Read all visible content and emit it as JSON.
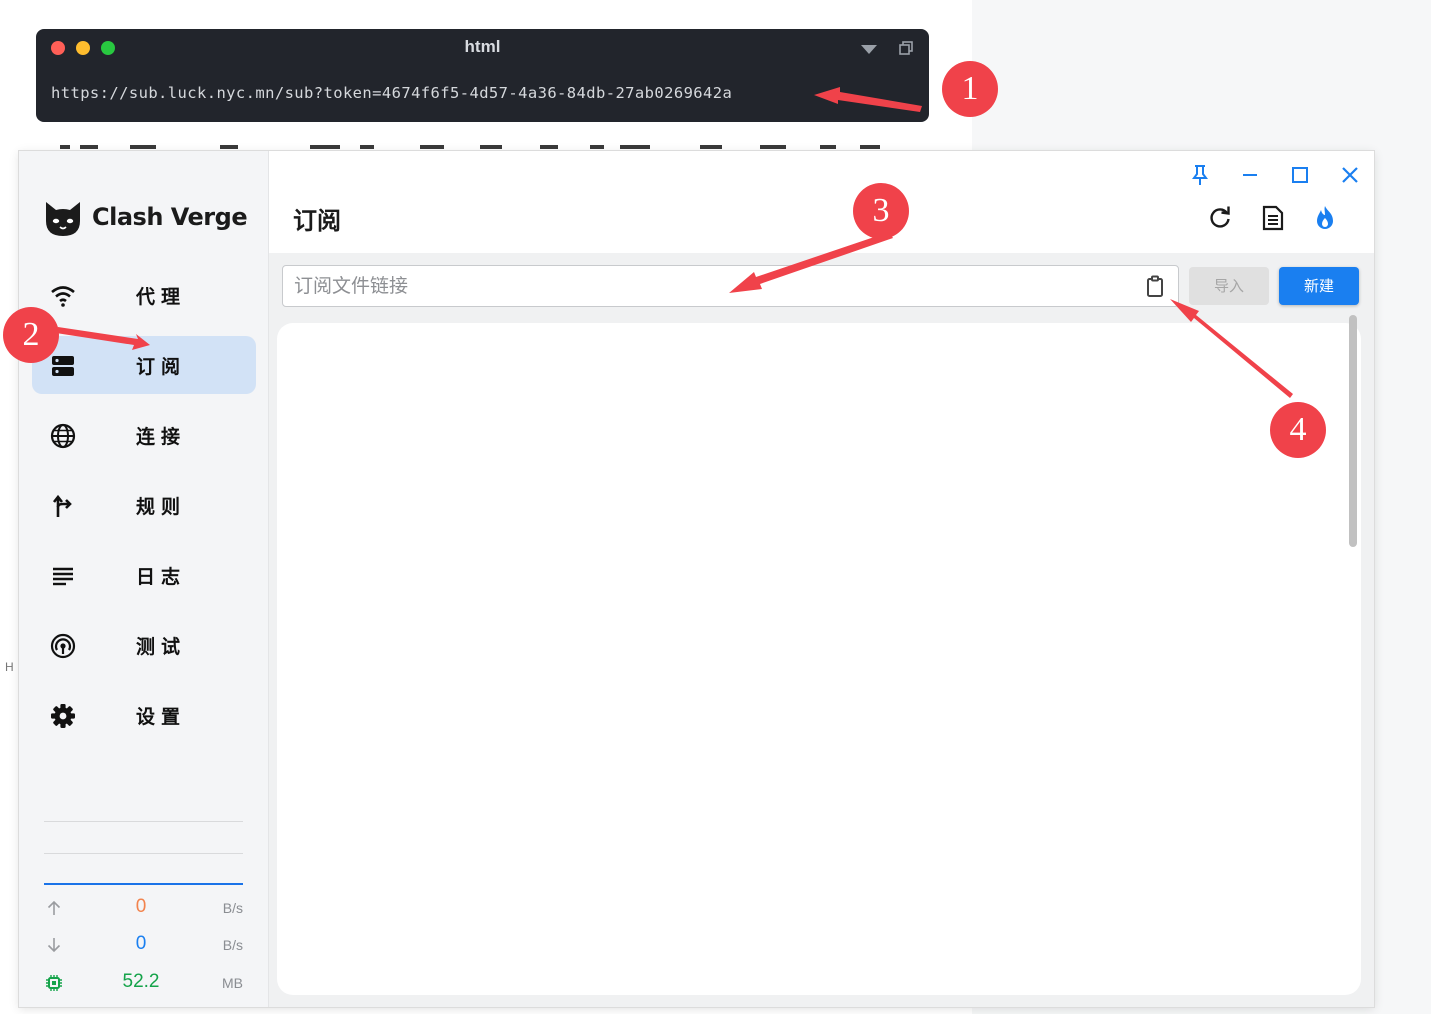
{
  "code_block": {
    "title": "html",
    "code": "https://sub.luck.nyc.mn/sub?token=4674f6f5-4d57-4a36-84db-27ab0269642a",
    "traffic_lights": [
      "#ff5f57",
      "#febc2e",
      "#28c840"
    ]
  },
  "side_note": "H",
  "app": {
    "brand": "Clash Verge",
    "accent": "#1a7ff0",
    "nav": [
      {
        "label": "代理",
        "icon": "wifi-icon"
      },
      {
        "label": "订阅",
        "icon": "server-icon",
        "active": true
      },
      {
        "label": "连接",
        "icon": "globe-icon"
      },
      {
        "label": "规则",
        "icon": "fork-icon"
      },
      {
        "label": "日志",
        "icon": "lines-icon"
      },
      {
        "label": "测试",
        "icon": "radar-icon"
      },
      {
        "label": "设置",
        "icon": "gear-icon"
      }
    ],
    "stats": {
      "upload": {
        "value": "0",
        "unit": "B/s",
        "color": "#f2834d"
      },
      "download": {
        "value": "0",
        "unit": "B/s",
        "color": "#1a7ff0"
      },
      "memory": {
        "value": "52.2",
        "unit": "MB",
        "color": "#15a34a"
      }
    }
  },
  "page": {
    "title": "订阅",
    "url_placeholder": "订阅文件链接",
    "import_label": "导入",
    "new_label": "新建"
  },
  "annotations": [
    "1",
    "2",
    "3",
    "4"
  ],
  "annotation_color": "#f0424a"
}
